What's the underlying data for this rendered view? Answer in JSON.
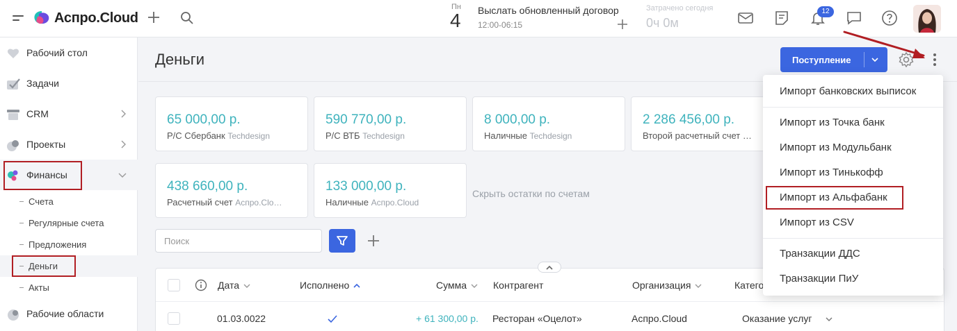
{
  "app": {
    "name": "Аспро.Cloud"
  },
  "topbar": {
    "day_name": "Пн",
    "day_number": "4",
    "task_title": "Выслать обновленный договор",
    "task_time": "12:00-06:15",
    "spent_label": "Затрачено сегодня",
    "spent_value": "0ч 0м",
    "notifications_count": "12"
  },
  "sidebar": {
    "items": [
      {
        "label": "Рабочий стол"
      },
      {
        "label": "Задачи"
      },
      {
        "label": "CRM"
      },
      {
        "label": "Проекты"
      },
      {
        "label": "Финансы"
      },
      {
        "label": "Рабочие области"
      }
    ],
    "finance_sub": [
      {
        "label": "Счета"
      },
      {
        "label": "Регулярные счета"
      },
      {
        "label": "Предложения"
      },
      {
        "label": "Деньги"
      },
      {
        "label": "Акты"
      }
    ]
  },
  "page": {
    "title": "Деньги",
    "primary_button": "Поступление",
    "hide_balances": "Скрыть остатки по счетам",
    "search_placeholder": "Поиск"
  },
  "accounts": [
    {
      "amount": "65 000,00 р.",
      "name": "Р/С Сбербанк",
      "org": "Techdesign"
    },
    {
      "amount": "590 770,00 р.",
      "name": "Р/С ВТБ",
      "org": "Techdesign"
    },
    {
      "amount": "8 000,00 р.",
      "name": "Наличные",
      "org": "Techdesign"
    },
    {
      "amount": "2 286 456,00 р.",
      "name": "Второй расчетный счет …",
      "org": ""
    },
    {
      "amount": "438 660,00 р.",
      "name": "Расчетный счет",
      "org": "Аспро.Clo…"
    },
    {
      "amount": "133 000,00 р.",
      "name": "Наличные",
      "org": "Аспро.Cloud"
    }
  ],
  "table": {
    "columns": [
      "Дата",
      "Исполнено",
      "Сумма",
      "Контрагент",
      "Организация",
      "Катего"
    ],
    "rows": [
      {
        "date": "01.03.0022",
        "amount": "+ 61 300,00 р.",
        "counterparty": "Ресторан «Оцелот»",
        "organization": "Аспро.Cloud",
        "category": "Оказание услуг"
      }
    ]
  },
  "menu": {
    "items": [
      "Импорт банковских выписок",
      "Импорт из Точка банк",
      "Импорт из Модульбанк",
      "Импорт из Тинькофф",
      "Импорт из Альфабанк",
      "Импорт из CSV",
      "Транзакции ДДС",
      "Транзакции ПиУ"
    ]
  },
  "colors": {
    "accent": "#3b66e0",
    "amount_teal": "#3fb3bd",
    "highlight_red": "#b11e23"
  }
}
